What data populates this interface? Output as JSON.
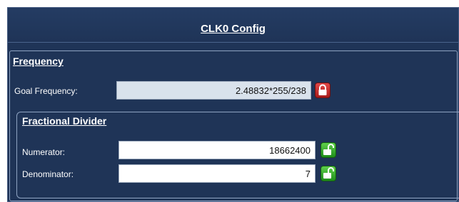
{
  "panel": {
    "title": "CLK0 Config"
  },
  "frequency": {
    "section_title": "Frequency",
    "goal_label": "Goal Frequency:",
    "goal_value": "2.48832*255/238",
    "goal_lock": "locked-padlock-icon"
  },
  "fractional_divider": {
    "section_title": "Fractional Divider",
    "numerator_label": "Numerator:",
    "numerator_value": "18662400",
    "numerator_lock": "unlocked-padlock-icon",
    "denominator_label": "Denominator:",
    "denominator_value": "7",
    "denominator_lock": "unlocked-padlock-icon"
  },
  "colors": {
    "panel_background": "#1f3457",
    "locked_button": "#c62828",
    "unlocked_button": "#3cb72e",
    "readonly_field": "#d9e2ec"
  }
}
